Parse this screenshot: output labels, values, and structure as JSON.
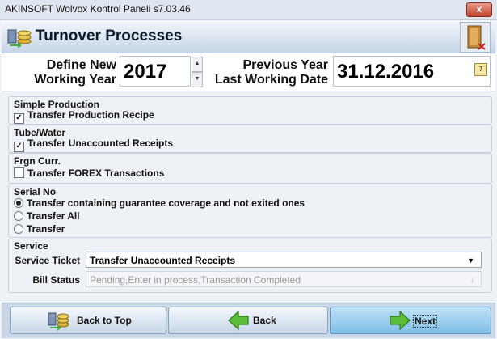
{
  "window": {
    "title": "AKINSOFT Wolvox Kontrol Paneli s7.03.46",
    "close_label": "x"
  },
  "header": {
    "title": "Turnover Processes"
  },
  "year_row": {
    "define_label_1": "Define New",
    "define_label_2": "Working Year",
    "year_value": "2017",
    "prev_label_1": "Previous Year",
    "prev_label_2": "Last Working Date",
    "prev_date": "31.12.2016"
  },
  "groups": {
    "simple_production": {
      "title": "Simple Production",
      "option": "Transfer Production Recipe",
      "checked": true
    },
    "tube_water": {
      "title": "Tube/Water",
      "option": "Transfer Unaccounted Receipts",
      "checked": true
    },
    "frgn_curr": {
      "title": "Frgn Curr.",
      "option": "Transfer FOREX Transactions",
      "checked": false
    },
    "serial_no": {
      "title": "Serial No",
      "options": [
        "Transfer containing guarantee coverage and not exited ones",
        "Transfer All",
        "Transfer"
      ],
      "selected": "Transfer containing guarantee coverage and not exited ones"
    },
    "service": {
      "title": "Service",
      "ticket_label": "Service Ticket",
      "ticket_value": "Transfer Unaccounted Receipts",
      "bill_label": "Bill Status",
      "bill_value": "Pending,Enter in process,Transaction Completed"
    }
  },
  "footer": {
    "back_to_top": "Back to Top",
    "back": "Back",
    "next": "Next"
  },
  "colors": {
    "accent": "#7fbde6",
    "header_bg": "#c7d5e6",
    "footer_bg": "#c9d6e6"
  }
}
